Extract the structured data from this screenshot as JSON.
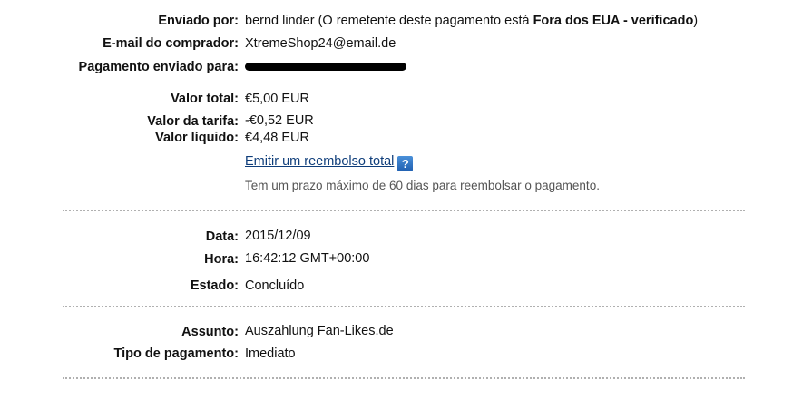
{
  "details": {
    "sent_by_label": "Enviado por:",
    "sent_by_name": "bernd linder",
    "sent_by_note_prefix": " (O remetente deste pagamento está ",
    "sent_by_status": "Fora dos EUA - verificado",
    "sent_by_note_suffix": ")",
    "buyer_email_label": "E-mail do comprador:",
    "buyer_email": "XtremeShop24@email.de",
    "payment_sent_to_label": "Pagamento enviado para:"
  },
  "amounts": {
    "total_label": "Valor total:",
    "total": "€5,00 EUR",
    "fee_label": "Valor da tarifa:",
    "fee": "-€0,52 EUR",
    "net_label": "Valor líquido:",
    "net": "€4,48 EUR",
    "refund_link": "Emitir um reembolso total",
    "help_icon_glyph": "?",
    "refund_note": "Tem um prazo máximo de 60 dias para reembolsar o pagamento."
  },
  "timing": {
    "date_label": "Data:",
    "date": "2015/12/09",
    "time_label": "Hora:",
    "time": "16:42:12 GMT+00:00",
    "status_label": "Estado:",
    "status": "Concluído"
  },
  "subject": {
    "subject_label": "Assunto:",
    "subject": "Auszahlung Fan-Likes.de",
    "payment_type_label": "Tipo de pagamento:",
    "payment_type": "Imediato"
  },
  "icons": {
    "help": "help-icon"
  },
  "colors": {
    "link": "#0e3d7a",
    "help_icon": "#2f74c8",
    "note_text": "#555555",
    "divider": "#b0b0b0"
  }
}
